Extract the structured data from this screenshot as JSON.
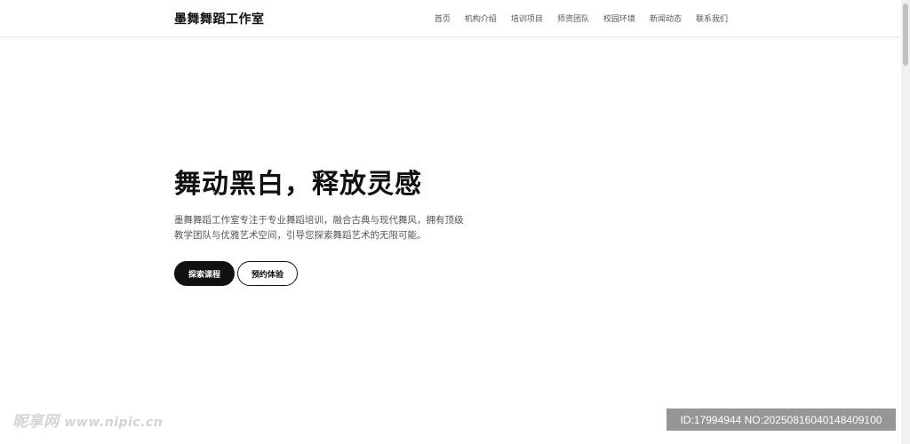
{
  "header": {
    "logo": "墨舞舞蹈工作室",
    "nav": [
      {
        "label": "首页"
      },
      {
        "label": "机构介绍"
      },
      {
        "label": "培训项目"
      },
      {
        "label": "师资团队"
      },
      {
        "label": "校园环境"
      },
      {
        "label": "新闻动态"
      },
      {
        "label": "联系我们"
      }
    ]
  },
  "hero": {
    "title": "舞动黑白，释放灵感",
    "description": "墨舞舞蹈工作室专注于专业舞蹈培训，融合古典与现代舞风，拥有顶级教学团队与优雅艺术空间，引导您探索舞蹈艺术的无限可能。",
    "primary_button": "探索课程",
    "secondary_button": "预约体验"
  },
  "watermark": {
    "brand": "昵享网",
    "url": "www.nipic.cn",
    "id_text": "ID:17994944 NO:20250816040148409100"
  },
  "colors": {
    "text": "#111111",
    "muted": "#555555",
    "primary_button_bg": "#111111",
    "background": "#ffffff"
  }
}
